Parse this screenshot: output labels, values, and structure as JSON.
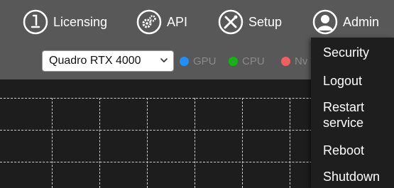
{
  "nav": {
    "licensing": {
      "label": "Licensing",
      "icon": "licensing-icon"
    },
    "api": {
      "label": "API",
      "icon": "gears-icon"
    },
    "setup": {
      "label": "Setup",
      "icon": "tools-icon"
    },
    "admin": {
      "label": "Admin",
      "icon": "user-icon"
    }
  },
  "gpu_select": {
    "value": "Quadro RTX 4000"
  },
  "legend": [
    {
      "label": "GPU",
      "color": "#1e90ff"
    },
    {
      "label": "CPU",
      "color": "#12b312"
    },
    {
      "label": "Nv",
      "color": "#f06060"
    }
  ],
  "admin_menu": {
    "items": [
      {
        "label": "Security"
      },
      {
        "label": "Logout"
      },
      {
        "label": "Restart service"
      },
      {
        "label": "Reboot"
      },
      {
        "label": "Shutdown"
      }
    ]
  },
  "colors": {
    "topbar": "#585858",
    "chart_bg": "#1d1d1d",
    "grid": "#cfcfcf",
    "menu_bg": "#1e1e1e"
  }
}
